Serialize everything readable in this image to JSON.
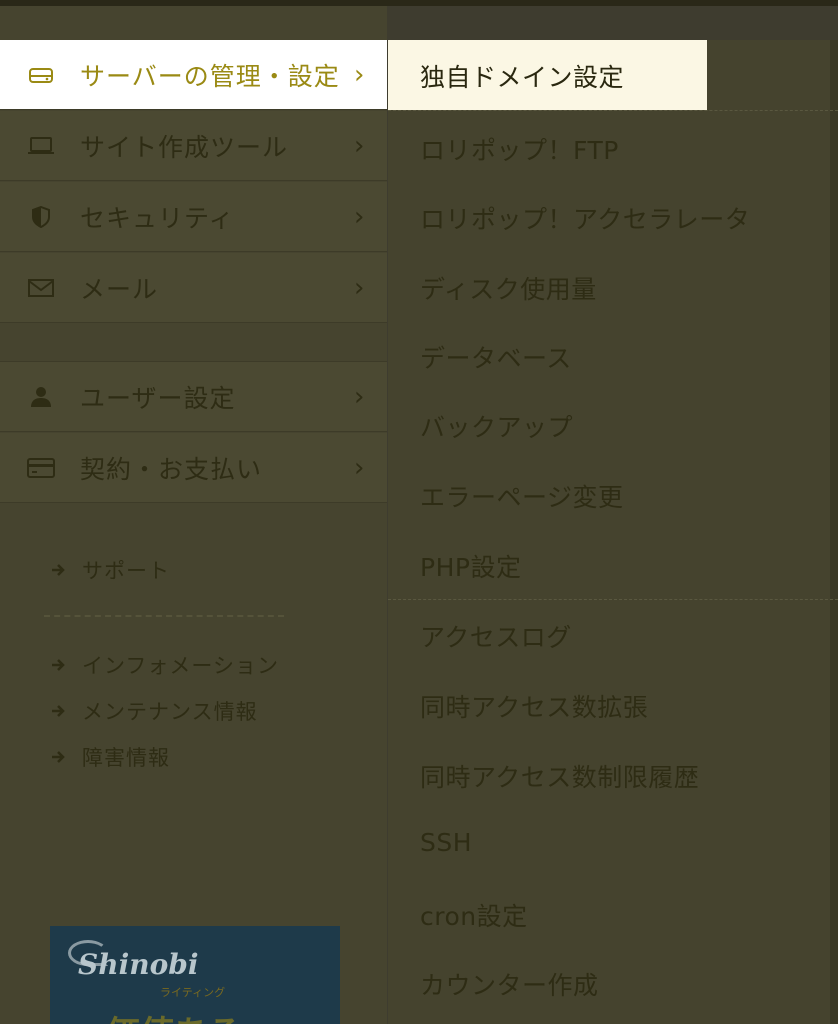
{
  "sidebar": {
    "items": [
      {
        "label": "サーバーの管理・設定",
        "icon": "server-icon",
        "active": true
      },
      {
        "label": "サイト作成ツール",
        "icon": "laptop-icon"
      },
      {
        "label": "セキュリティ",
        "icon": "shield-icon"
      },
      {
        "label": "メール",
        "icon": "mail-icon"
      },
      {
        "label": "ユーザー設定",
        "icon": "user-icon"
      },
      {
        "label": "契約・お支払い",
        "icon": "credit-card-icon"
      }
    ],
    "chevron": "›",
    "support_links": [
      {
        "label": "サポート"
      },
      {
        "label": "インフォメーション"
      },
      {
        "label": "メンテナンス情報"
      },
      {
        "label": "障害情報"
      }
    ],
    "banner": {
      "logo": "Shinobi",
      "sub": "ライティング",
      "big": "価値ある"
    }
  },
  "submenu": {
    "items": [
      {
        "label": "独自ドメイン設定",
        "active": true
      },
      {
        "label": "ロリポップ！FTP"
      },
      {
        "label": "ロリポップ！アクセラレータ"
      },
      {
        "label": "ディスク使用量"
      },
      {
        "label": "データベース"
      },
      {
        "label": "バックアップ"
      },
      {
        "label": "エラーページ変更"
      },
      {
        "label": "PHP設定"
      },
      {
        "label": "アクセスログ"
      },
      {
        "label": "同時アクセス数拡張"
      },
      {
        "label": "同時アクセス数制限履歴"
      },
      {
        "label": "SSH"
      },
      {
        "label": "cron設定"
      },
      {
        "label": "カウンター作成"
      }
    ]
  },
  "colors": {
    "accent": "#9a8a14",
    "active_sub_bg": "#fbf7e4",
    "overlay_bg": "#46442f"
  }
}
